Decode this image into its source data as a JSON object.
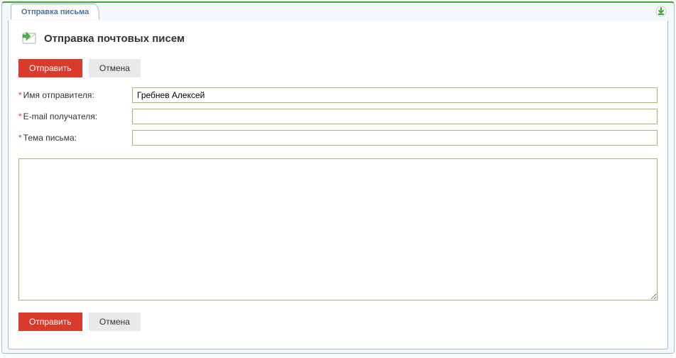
{
  "tab": {
    "label": "Отправка письма"
  },
  "header": {
    "title": "Отправка почтовых писем"
  },
  "buttons": {
    "send": "Отправить",
    "cancel": "Отмена"
  },
  "form": {
    "sender": {
      "label": "Имя отправителя:",
      "value": "Гребнев Алексей"
    },
    "recipient": {
      "label": "E-mail получателя:",
      "value": ""
    },
    "subject": {
      "label": "Тема письма:",
      "value": ""
    },
    "body": {
      "value": ""
    }
  },
  "required_marker": "*"
}
